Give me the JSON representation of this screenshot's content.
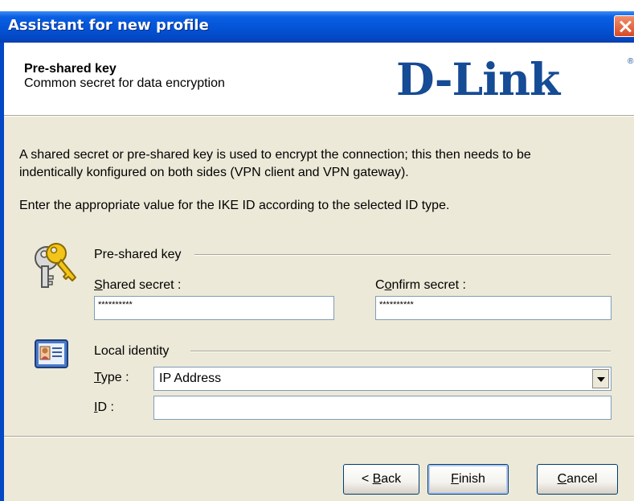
{
  "window": {
    "title": "Assistant for new profile"
  },
  "header": {
    "title": "Pre-shared key",
    "subtitle": "Common secret for data encryption",
    "logo_text": "D-Link",
    "logo_reg": "®"
  },
  "intro": {
    "line1": "A shared secret or pre-shared key is used to encrypt the connection; this then needs to be",
    "line2": "indentically konfigured on both sides (VPN client and VPN gateway).",
    "line3": "Enter the appropriate value for the IKE ID according to the selected ID type."
  },
  "psk_section": {
    "title": "Pre-shared key",
    "shared_secret_key": "S",
    "shared_secret_rest": "hared secret  :",
    "shared_secret_value": "**********",
    "confirm_pre": "C",
    "confirm_key": "o",
    "confirm_rest": "nfirm secret :",
    "confirm_value": "**********"
  },
  "identity_section": {
    "title": "Local identity",
    "type_key": "T",
    "type_rest": "ype :",
    "type_value": "IP Address",
    "id_key": "I",
    "id_rest": "D :",
    "id_value": ""
  },
  "buttons": {
    "back_pre": "< ",
    "back_key": "B",
    "back_rest": "ack",
    "finish_key": "F",
    "finish_rest": "inish",
    "cancel_key": "C",
    "cancel_rest": "ancel"
  },
  "colors": {
    "titlebar": "#0453d6",
    "dialog_bg": "#ece9d8",
    "logo": "#164b95"
  },
  "icons": {
    "close": "close-icon",
    "keys": "keys-icon",
    "identity": "id-card-icon",
    "dropdown": "chevron-down-icon"
  }
}
